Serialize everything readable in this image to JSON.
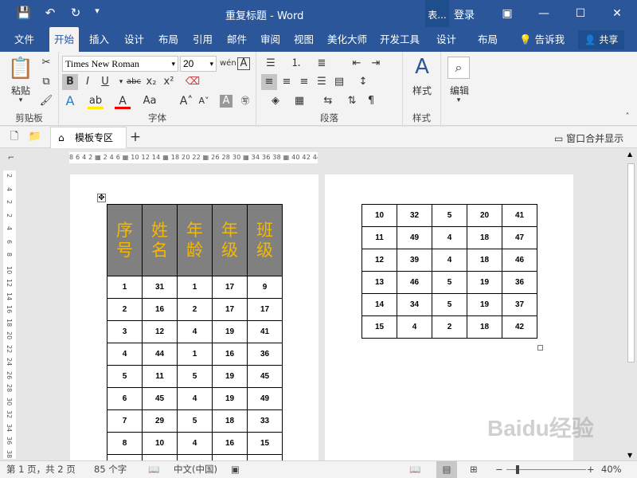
{
  "titlebar": {
    "title": "重复标题  -  Word",
    "context_tab": "表...",
    "login": "登录"
  },
  "tabs": [
    "文件",
    "开始",
    "插入",
    "设计",
    "布局",
    "引用",
    "邮件",
    "审阅",
    "视图",
    "美化大师",
    "开发工具",
    "设计",
    "布局"
  ],
  "active_tab": "开始",
  "tell_me": "告诉我",
  "share": "共享",
  "ribbon": {
    "clipboard": {
      "paste": "粘贴",
      "label": "剪贴板"
    },
    "font": {
      "name": "Times New Roman",
      "size": "20",
      "label": "字体"
    },
    "paragraph": {
      "label": "段落"
    },
    "styles": {
      "button": "样式",
      "label": "样式"
    },
    "editing": {
      "button": "编辑"
    }
  },
  "docbar": {
    "tab": "模板专区",
    "add": "+",
    "merge": "窗口合并显示"
  },
  "ruler": {
    "h": "8  6  4  2  ▦  2  4  6 ▦ 10 12 14 ▦ 18 20 22 ▦ 26 28 30 ▦ 34 36 38 ▦ 40 42 44 46",
    "v": [
      "2",
      "4",
      "2",
      "2",
      "4",
      "6",
      "8",
      "10",
      "12",
      "14",
      "16",
      "18",
      "20",
      "22",
      "24",
      "26",
      "28",
      "30",
      "32",
      "34",
      "36",
      "38"
    ]
  },
  "table": {
    "headers": [
      "序号",
      "姓名",
      "年龄",
      "年级",
      "班级"
    ],
    "page1_rows": [
      [
        "1",
        "31",
        "1",
        "17",
        "9"
      ],
      [
        "2",
        "16",
        "2",
        "17",
        "17"
      ],
      [
        "3",
        "12",
        "4",
        "19",
        "41"
      ],
      [
        "4",
        "44",
        "1",
        "16",
        "36"
      ],
      [
        "5",
        "11",
        "5",
        "19",
        "45"
      ],
      [
        "6",
        "45",
        "4",
        "19",
        "49"
      ],
      [
        "7",
        "29",
        "5",
        "18",
        "33"
      ],
      [
        "8",
        "10",
        "4",
        "16",
        "15"
      ],
      [
        "",
        "",
        "",
        "",
        ""
      ]
    ],
    "page2_rows": [
      [
        "10",
        "32",
        "5",
        "20",
        "41"
      ],
      [
        "11",
        "49",
        "4",
        "18",
        "47"
      ],
      [
        "12",
        "39",
        "4",
        "18",
        "46"
      ],
      [
        "13",
        "46",
        "5",
        "19",
        "36"
      ],
      [
        "14",
        "34",
        "5",
        "19",
        "37"
      ],
      [
        "15",
        "4",
        "2",
        "18",
        "42"
      ]
    ]
  },
  "status": {
    "page": "第 1 页，共 2 页",
    "words": "85 个字",
    "lang": "中文(中国)",
    "zoom": "40%"
  },
  "watermark": "Baidu经验",
  "colors": {
    "ribbon_blue": "#2b579a",
    "header_gray": "#808080",
    "header_text": "#f5b800"
  }
}
